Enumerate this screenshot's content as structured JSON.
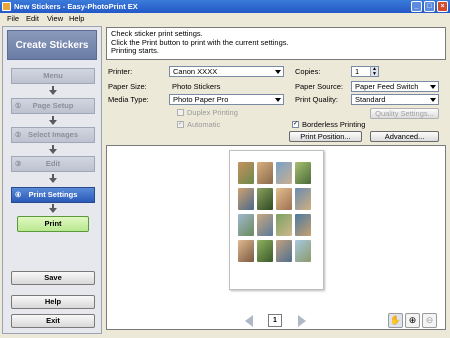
{
  "window": {
    "title": "New Stickers - Easy-PhotoPrint EX",
    "minimize": "_",
    "maximize": "□",
    "close": "×"
  },
  "menubar": [
    "File",
    "Edit",
    "View",
    "Help"
  ],
  "sidebar": {
    "title": "Create Stickers",
    "steps": [
      {
        "num": "",
        "label": "Menu"
      },
      {
        "num": "①",
        "label": "Page Setup"
      },
      {
        "num": "②",
        "label": "Select Images"
      },
      {
        "num": "③",
        "label": "Edit"
      },
      {
        "num": "④",
        "label": "Print Settings"
      }
    ],
    "print": "Print",
    "save": "Save",
    "help": "Help",
    "exit": "Exit"
  },
  "info": {
    "line1": "Check sticker print settings.",
    "line2": "Click the Print button to print with the current settings.",
    "line3": "Printing starts."
  },
  "settings": {
    "printer_label": "Printer:",
    "printer_value": "Canon XXXX",
    "paper_size_label": "Paper Size:",
    "paper_size_value": "Photo Stickers",
    "media_type_label": "Media Type:",
    "media_type_value": "Photo Paper Pro",
    "copies_label": "Copies:",
    "copies_value": "1",
    "paper_source_label": "Paper Source:",
    "paper_source_value": "Paper Feed Switch",
    "print_quality_label": "Print Quality:",
    "print_quality_value": "Standard",
    "duplex_label": "Duplex Printing",
    "automatic_label": "Automatic",
    "automatic_checked": "✓",
    "borderless_label": "Borderless Printing",
    "borderless_checked": "✓",
    "quality_settings": "Quality Settings...",
    "print_position": "Print Position...",
    "advanced": "Advanced..."
  },
  "preview": {
    "page_number": "1",
    "hand_icon": "✋",
    "zoom_in_icon": "⊕",
    "zoom_out_icon": "⊖"
  },
  "colors": {
    "active_step": "#2a5ab8",
    "print_button": "#b8e890"
  }
}
